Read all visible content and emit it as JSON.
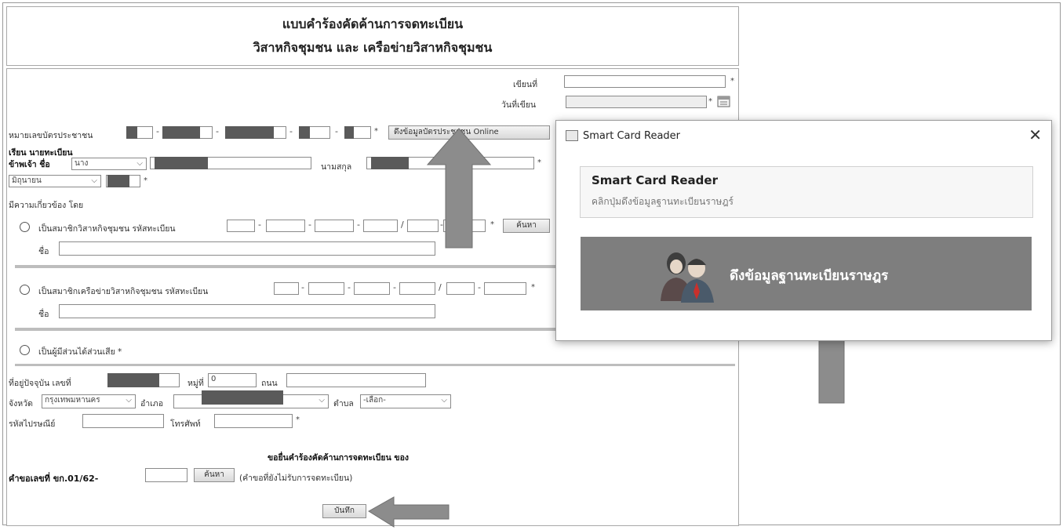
{
  "header": {
    "title1": "แบบคำร้องคัดค้านการจดทะเบียน",
    "title2": "วิสาหกิจชุมชน และ เครือข่ายวิสาหกิจชุมชน"
  },
  "form": {
    "written_at_label": "เขียนที่",
    "written_date_label": "วันที่เขียน",
    "id_label": "หมายเลขบัตรประชาชน",
    "fetch_id_button": "ดึงข้อมูลบัตรประชาชน Online",
    "dear_label": "เรียน นายทะเบียน",
    "i_name_label": "ข้าพเจ้า ชื่อ",
    "title_select": "นาง",
    "surname_label": "นามสกุล",
    "birth_month_select": "มิถุนายน",
    "related_label": "มีความเกี่ยวข้อง โดย",
    "member_enterprise_label": "เป็นสมาชิกวิสาหกิจชุมชน รหัสทะเบียน",
    "search_button": "ค้นหา",
    "name_label": "ชื่อ",
    "member_network_label": "เป็นสมาชิกเครือข่ายวิสาหกิจชุมชน รหัสทะเบียน",
    "stakeholder_label": "เป็นผู้มีส่วนได้ส่วนเสีย *",
    "address_label": "ที่อยู่ปัจจุบัน เลขที่",
    "moo_label": "หมู่ที่",
    "moo_value": "0",
    "road_label": "ถนน",
    "province_label": "จังหวัด",
    "province_value": "กรุงเทพมหานคร",
    "district_label": "อำเภอ",
    "subdistrict_label": "ตำบล",
    "subdistrict_value": "-เลือก-",
    "postcode_label": "รหัสไปรษณีย์",
    "phone_label": "โทรศัพท์",
    "objection_heading": "ขอยื่นคำร้องคัดค้านการจดทะเบียน ของ",
    "request_no_label": "คำขอเลขที่ ขก.01/62-",
    "search_button2": "ค้นหา",
    "pending_note": "(คำขอที่ยังไม่รับการจดทะเบียน)",
    "save_button": "บันทึก",
    "star": "*"
  },
  "dialog": {
    "title": "Smart Card Reader",
    "card_heading": "Smart Card Reader",
    "card_sub": "คลิกปุ่มดึงข้อมูลฐานทะเบียนราษฎร์",
    "fetch_button": "ดึงข้อมูลฐานทะเบียนราษฎร"
  },
  "icons": {
    "close": "close-icon",
    "calendar": "calendar-icon",
    "card_reader": "card-reader-icon",
    "people": "people-icon",
    "chevron": "chevron-down-icon"
  },
  "colors": {
    "annotation_arrow": "#8c8c8c",
    "fetch_button_bg": "#7e7e7e",
    "redaction": "#5a5a5a"
  }
}
